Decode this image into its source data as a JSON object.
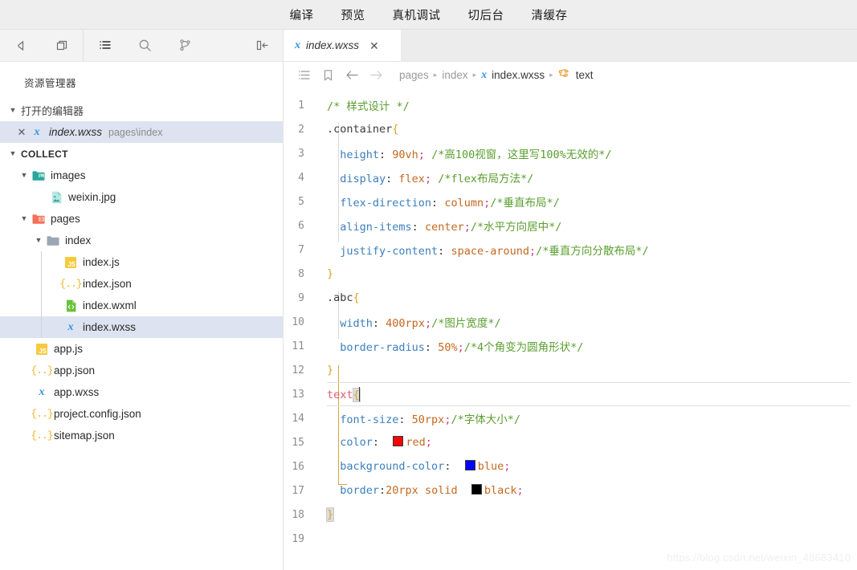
{
  "topbar": {
    "items": [
      {
        "label": "编译",
        "name": "compile"
      },
      {
        "label": "预览",
        "name": "preview"
      },
      {
        "label": "真机调试",
        "name": "real-device-debug"
      },
      {
        "label": "切后台",
        "name": "switch-background"
      },
      {
        "label": "清缓存",
        "name": "clear-cache"
      }
    ]
  },
  "rail": {
    "icons": [
      {
        "name": "simulator-icon",
        "glyph": "play-triangle"
      },
      {
        "name": "window-panels-icon",
        "glyph": "panels"
      },
      {
        "name": "explorer-icon",
        "glyph": "list"
      },
      {
        "name": "search-icon",
        "glyph": "magnifier"
      },
      {
        "name": "source-control-icon",
        "glyph": "branch"
      },
      {
        "name": "collapse-sidebar-icon",
        "glyph": "collapse-left"
      }
    ]
  },
  "explorer": {
    "title": "资源管理器",
    "open_editors": {
      "label": "打开的编辑器",
      "expanded": true,
      "items": [
        {
          "name": "index.wxss",
          "meta": "pages\\index",
          "icon": "wxss",
          "selected": true
        }
      ]
    },
    "project": {
      "label": "COLLECT",
      "expanded": true,
      "tree": [
        {
          "label": "images",
          "icon": "folder-images",
          "type": "folder",
          "depth": 1,
          "expanded": true
        },
        {
          "label": "weixin.jpg",
          "icon": "image",
          "type": "file",
          "depth": 2
        },
        {
          "label": "pages",
          "icon": "folder-pages",
          "type": "folder",
          "depth": 1,
          "expanded": true
        },
        {
          "label": "index",
          "icon": "folder",
          "type": "folder",
          "depth": 2,
          "expanded": true
        },
        {
          "label": "index.js",
          "icon": "js",
          "type": "file",
          "depth": 3
        },
        {
          "label": "index.json",
          "icon": "json",
          "type": "file",
          "depth": 3
        },
        {
          "label": "index.wxml",
          "icon": "wxml",
          "type": "file",
          "depth": 3
        },
        {
          "label": "index.wxss",
          "icon": "wxss",
          "type": "file",
          "depth": 3,
          "selected": true
        },
        {
          "label": "app.js",
          "icon": "js",
          "type": "file",
          "depth": 1
        },
        {
          "label": "app.json",
          "icon": "json",
          "type": "file",
          "depth": 1
        },
        {
          "label": "app.wxss",
          "icon": "wxss",
          "type": "file",
          "depth": 1
        },
        {
          "label": "project.config.json",
          "icon": "json",
          "type": "file",
          "depth": 1
        },
        {
          "label": "sitemap.json",
          "icon": "json",
          "type": "file",
          "depth": 1
        }
      ]
    }
  },
  "editor": {
    "tab": {
      "label": "index.wxss",
      "icon": "wxss",
      "close": "✕"
    },
    "breadcrumb": {
      "buttons": [
        {
          "name": "outline-icon"
        },
        {
          "name": "bookmark-icon"
        },
        {
          "name": "back-arrow-icon"
        },
        {
          "name": "forward-arrow-icon"
        }
      ],
      "crumbs": [
        {
          "label": "pages",
          "strong": false,
          "icon": null
        },
        {
          "label": "index",
          "strong": false,
          "icon": null
        },
        {
          "label": "index.wxss",
          "strong": true,
          "icon": "wxss"
        },
        {
          "label": "text",
          "strong": true,
          "icon": "selector"
        }
      ],
      "separator": "▸"
    },
    "current_line": 13,
    "lines": [
      {
        "n": 1,
        "tokens": [
          {
            "t": "comment",
            "v": "/* 样式设计 */"
          }
        ]
      },
      {
        "n": 2,
        "tokens": [
          {
            "t": "selector",
            "v": ".container"
          },
          {
            "t": "brace",
            "v": "{"
          }
        ]
      },
      {
        "n": 3,
        "indent": 1,
        "tokens": [
          {
            "t": "prop",
            "v": "  height"
          },
          {
            "t": "plain",
            "v": ":"
          },
          {
            "t": "value",
            "v": " 90vh"
          },
          {
            "t": "punc",
            "v": ";"
          },
          {
            "t": "comment",
            "v": " /*高100视窗，这里写100%无效的*/"
          }
        ]
      },
      {
        "n": 4,
        "indent": 1,
        "tokens": [
          {
            "t": "prop",
            "v": "  display"
          },
          {
            "t": "plain",
            "v": ":"
          },
          {
            "t": "value",
            "v": " flex"
          },
          {
            "t": "punc",
            "v": ";"
          },
          {
            "t": "comment",
            "v": " /*flex布局方法*/"
          }
        ]
      },
      {
        "n": 5,
        "indent": 1,
        "tokens": [
          {
            "t": "prop",
            "v": "  flex-direction"
          },
          {
            "t": "plain",
            "v": ":"
          },
          {
            "t": "value",
            "v": " column"
          },
          {
            "t": "punc",
            "v": ";"
          },
          {
            "t": "comment",
            "v": "/*垂直布局*/"
          }
        ]
      },
      {
        "n": 6,
        "indent": 1,
        "tokens": [
          {
            "t": "prop",
            "v": "  align-items"
          },
          {
            "t": "plain",
            "v": ":"
          },
          {
            "t": "value",
            "v": " center"
          },
          {
            "t": "punc",
            "v": ";"
          },
          {
            "t": "comment",
            "v": "/*水平方向居中*/"
          }
        ]
      },
      {
        "n": 7,
        "indent": 1,
        "tokens": [
          {
            "t": "prop",
            "v": "  justify-content"
          },
          {
            "t": "plain",
            "v": ":"
          },
          {
            "t": "value",
            "v": " space-around"
          },
          {
            "t": "punc",
            "v": ";"
          },
          {
            "t": "comment",
            "v": "/*垂直方向分散布局*/"
          }
        ]
      },
      {
        "n": 8,
        "tokens": [
          {
            "t": "brace",
            "v": "}"
          }
        ]
      },
      {
        "n": 9,
        "tokens": [
          {
            "t": "selector",
            "v": ".abc"
          },
          {
            "t": "brace",
            "v": "{"
          }
        ]
      },
      {
        "n": 10,
        "indent": 1,
        "tokens": [
          {
            "t": "prop",
            "v": "  width"
          },
          {
            "t": "plain",
            "v": ":"
          },
          {
            "t": "value",
            "v": " 400rpx"
          },
          {
            "t": "punc",
            "v": ";"
          },
          {
            "t": "comment",
            "v": "/*图片宽度*/"
          }
        ]
      },
      {
        "n": 11,
        "indent": 1,
        "tokens": [
          {
            "t": "prop",
            "v": "  border-radius"
          },
          {
            "t": "plain",
            "v": ":"
          },
          {
            "t": "value",
            "v": " 50%"
          },
          {
            "t": "punc",
            "v": ";"
          },
          {
            "t": "comment",
            "v": "/*4个角变为圆角形状*/"
          }
        ]
      },
      {
        "n": 12,
        "tokens": [
          {
            "t": "brace",
            "v": "}"
          }
        ]
      },
      {
        "n": 13,
        "current": true,
        "tokens": [
          {
            "t": "selector",
            "v": "text"
          },
          {
            "t": "brace-box",
            "v": "{"
          },
          {
            "t": "caret",
            "v": ""
          }
        ]
      },
      {
        "n": 14,
        "indent": 1,
        "tokens": [
          {
            "t": "prop",
            "v": "  font-size"
          },
          {
            "t": "plain",
            "v": ":"
          },
          {
            "t": "value",
            "v": " 50rpx"
          },
          {
            "t": "punc",
            "v": ";"
          },
          {
            "t": "comment",
            "v": "/*字体大小*/"
          }
        ]
      },
      {
        "n": 15,
        "indent": 1,
        "tokens": [
          {
            "t": "prop",
            "v": "  color"
          },
          {
            "t": "plain",
            "v": ":"
          },
          {
            "t": "plain",
            "v": "  "
          },
          {
            "t": "swatch",
            "v": "#ff0000"
          },
          {
            "t": "value",
            "v": "red"
          },
          {
            "t": "punc",
            "v": ";"
          }
        ]
      },
      {
        "n": 16,
        "indent": 1,
        "tokens": [
          {
            "t": "prop",
            "v": "  background-color"
          },
          {
            "t": "plain",
            "v": ":"
          },
          {
            "t": "plain",
            "v": "  "
          },
          {
            "t": "swatch",
            "v": "#0000ff"
          },
          {
            "t": "value",
            "v": "blue"
          },
          {
            "t": "punc",
            "v": ";"
          }
        ]
      },
      {
        "n": 17,
        "indent": 1,
        "tokens": [
          {
            "t": "prop",
            "v": "  border"
          },
          {
            "t": "plain",
            "v": ":"
          },
          {
            "t": "value",
            "v": "20rpx"
          },
          {
            "t": "plain",
            "v": " "
          },
          {
            "t": "value",
            "v": "solid"
          },
          {
            "t": "plain",
            "v": "  "
          },
          {
            "t": "swatch",
            "v": "#000000"
          },
          {
            "t": "value",
            "v": "black"
          },
          {
            "t": "punc",
            "v": ";"
          }
        ]
      },
      {
        "n": 18,
        "tokens": [
          {
            "t": "brace-box",
            "v": "}"
          }
        ]
      },
      {
        "n": 19,
        "tokens": []
      }
    ]
  },
  "watermark": "https://blog.csdn.net/weixin_48683410",
  "colors": {
    "accent_blue": "#2f95e6",
    "folder_images": "#2aa79b",
    "folder_pages": "#f4705a",
    "folder_plain": "#9aa7b5",
    "js_yellow": "#f7ca3e",
    "json_yellow": "#f0b429",
    "wxml_green": "#67c23a",
    "selection_bg": "#dde3f0",
    "comment_green": "#5a9e2f",
    "prop_blue": "#3c7fbd",
    "value_orange": "#c4681f",
    "punc_magenta": "#cc3f86",
    "selector_red": "#e05c6e",
    "brace_gold": "#d9a328"
  }
}
